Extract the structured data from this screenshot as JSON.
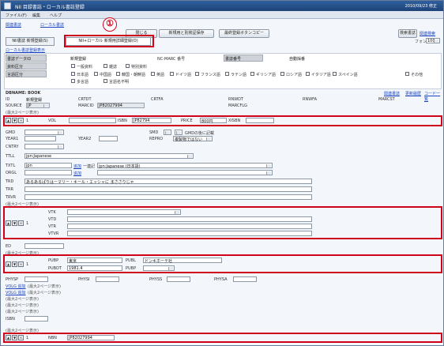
{
  "window": {
    "title": "NII 目録書誌・ローカル書誌登録",
    "date": "2010/09/23 修正"
  },
  "menu": [
    "ファイル(F)",
    "編集",
    "ヘルプ"
  ],
  "links": {
    "top1": "関連書誌",
    "top2": "ローカル書誌",
    "help": "関連検索",
    "font_label": "フォント"
  },
  "font_size": "100",
  "buttons": {
    "close": "閉じる",
    "new_save": "新規用と別検証保存",
    "detail": "最終登録ボタンコピー",
    "search": "検索書誌"
  },
  "tabs": {
    "nii_new": "NII書誌 新規登録(S)",
    "local_new": "NII+ローカル 新規用詳細登録(O)"
  },
  "callout_number": "①",
  "local_link": "ローカル書誌登録表示",
  "meta": {
    "data_type_label": "書誌データID",
    "data_type_value": "新規登録",
    "nc_label": "NC-MARC 番号",
    "shelf_label": "書誌番号",
    "shelf_value": "自動採番",
    "cat_label": "資料区分",
    "lang_label": "言語区分",
    "cat_options": [
      "一般資料",
      "雑誌",
      "特別資料"
    ],
    "lang_options": [
      "日本語",
      "中国語",
      "韓国・朝鮮語",
      "英語",
      "ドイツ語",
      "フランス語",
      "ラテン語",
      "ギリシア語",
      "ロシア語",
      "イタリア語",
      "スペイン語",
      "その他",
      "多言語",
      "言語名不明"
    ]
  },
  "record": {
    "header": "DBNAME: BOOK",
    "id_label": "ID",
    "id_value": "新規登録",
    "crtdt": "CRTDT",
    "crtfa": "CRTFA",
    "rnwdt": "RNWDT",
    "rnwfa": "RNWFA",
    "marcst": "MARCST",
    "source_label": "SOURCE",
    "source_value": "JP",
    "marcid_label": "MARCID",
    "marcid_value": "JP82027994",
    "marcflg": "MARCFLG",
    "right_link1": "関連書誌",
    "right_link2": "更新履歴",
    "right_link3": "コード一覧"
  },
  "vol": {
    "vol": "VOL",
    "isbn": "ISBN",
    "isbn_value": "JP82794",
    "price": "PRICE",
    "price_value": "800円",
    "xisbn": "XISBN"
  },
  "fields": {
    "gmd": "GMD",
    "gmd2": "GMD",
    "smd": "SMD",
    "smd_note": "GMDの後に記載",
    "yearl": "YEAR1",
    "year2": "YEAR2",
    "repro": "REPRO",
    "repro_value": "複製物ではない",
    "cntry": "CNTRY",
    "ttll": "TTLL",
    "ttll_value": "jpn:Japanese",
    "txtl": "TXTL",
    "txtl_value": "jpn",
    "orgl": "ORGL",
    "txtl_sub": "一連記",
    "txtl_sub_value": "jpn:Japanese (日本語)",
    "trd": "TRD",
    "trd_value": "あるあるぱりはーマリー・キール・エッシャに まささりじゃ",
    "trr": "TRR",
    "trvr": "TRVR"
  },
  "vt": {
    "vtk": "VTK",
    "vtd": "VTD",
    "vtr": "VTR",
    "vtvr": "VTVR"
  },
  "ed": "ED",
  "pub": {
    "pubp": "PUBP",
    "pubp_value": "東京",
    "publ": "PUBL",
    "publ_value": "ドンキホーテ社",
    "pubdt": "PUBDT",
    "pubdt_value": "1981.4",
    "pubp2": "PUBP"
  },
  "phys": {
    "physp": "PHYSP",
    "physi": "PHYSI",
    "physs": "PHYSS",
    "physa": "PHYSA"
  },
  "notes": [
    "VOLG 追加",
    "VOLG 追加",
    "(最大2ページ表示)",
    "(最大2ページ表示)",
    "(最大2ページ表示)",
    "(最大2ページ表示)",
    "(最大2ページ表示)"
  ],
  "bottom": {
    "isbn": "ISBN",
    "nbn": "NBN",
    "nbn_value": "JP82027994",
    "lccn": "LCCN"
  }
}
